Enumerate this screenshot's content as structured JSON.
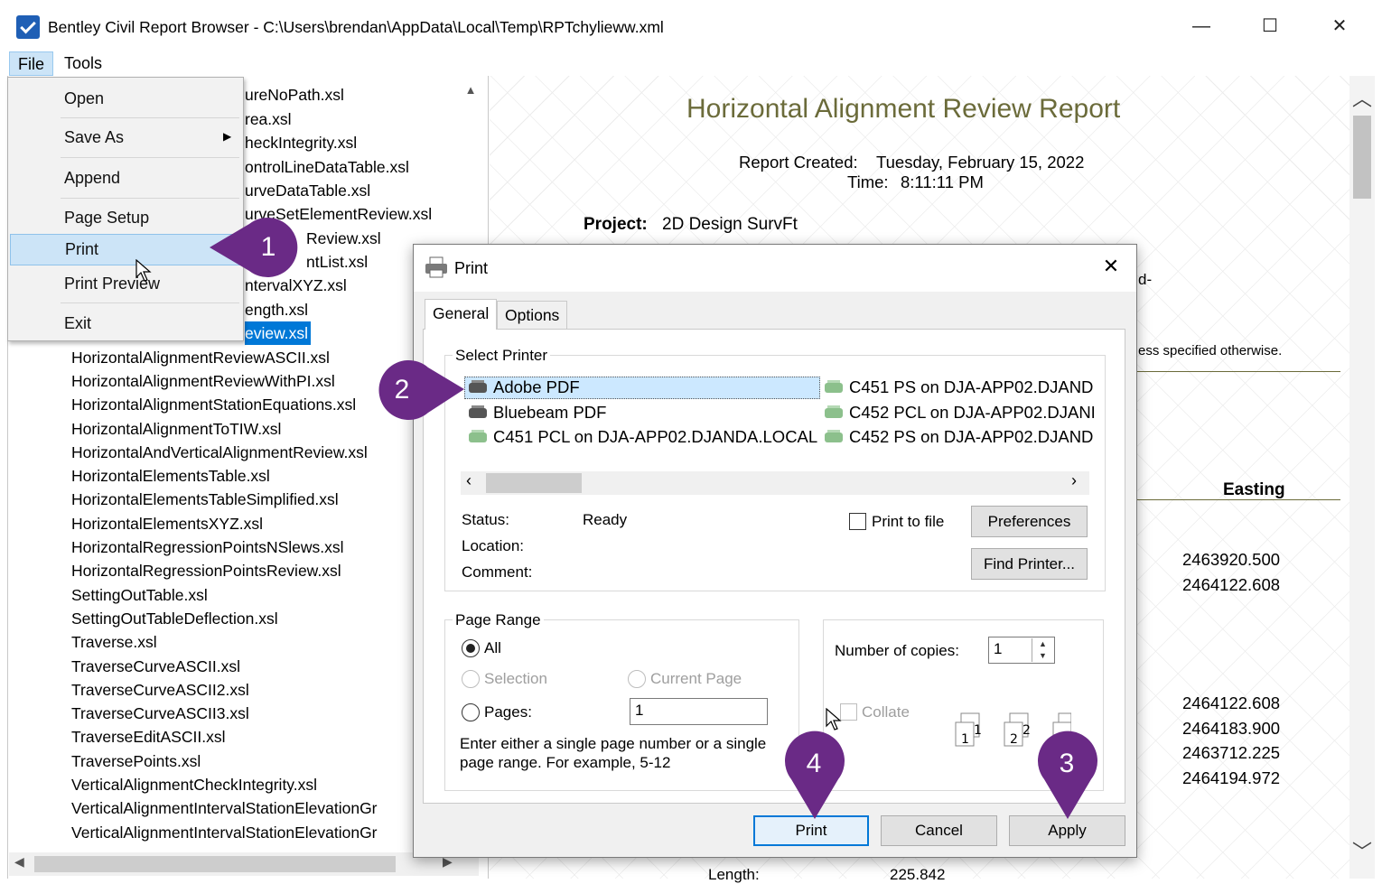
{
  "window": {
    "title": "Bentley Civil Report Browser - C:\\Users\\brendan\\AppData\\Local\\Temp\\RPTchylieww.xml",
    "minimize": "—",
    "maximize": "☐",
    "close": "✕"
  },
  "menubar": {
    "file": "File",
    "tools": "Tools"
  },
  "file_menu": {
    "open": "Open",
    "save_as": "Save As",
    "append": "Append",
    "page_setup": "Page Setup",
    "print": "Print",
    "print_preview": "Print Preview",
    "exit": "Exit"
  },
  "xsl_list": {
    "partial_rows": [
      "ureNoPath.xsl",
      "rea.xsl",
      "heckIntegrity.xsl",
      "ontrolLineDataTable.xsl",
      "urveDataTable.xsl",
      "urveSetElementReview.xsl",
      "Review.xsl",
      "ntList.xsl",
      "ntervalXYZ.xsl",
      "ength.xsl",
      "eview.xsl"
    ],
    "rows": [
      "HorizontalAlignmentReviewASCII.xsl",
      "HorizontalAlignmentReviewWithPI.xsl",
      "HorizontalAlignmentStationEquations.xsl",
      "HorizontalAlignmentToTIW.xsl",
      "HorizontalAndVerticalAlignmentReview.xsl",
      "HorizontalElementsTable.xsl",
      "HorizontalElementsTableSimplified.xsl",
      "HorizontalElementsXYZ.xsl",
      "HorizontalRegressionPointsNSlews.xsl",
      "HorizontalRegressionPointsReview.xsl",
      "SettingOutTable.xsl",
      "SettingOutTableDeflection.xsl",
      "Traverse.xsl",
      "TraverseCurveASCII.xsl",
      "TraverseCurveASCII2.xsl",
      "TraverseCurveASCII3.xsl",
      "TraverseEditASCII.xsl",
      "TraversePoints.xsl",
      "VerticalAlignmentCheckIntegrity.xsl",
      "VerticalAlignmentIntervalStationElevationGr",
      "VerticalAlignmentIntervalStationElevationGr"
    ]
  },
  "report": {
    "title": "Horizontal Alignment Review Report",
    "created_label": "Report Created:",
    "created_value": "Tuesday, February 15, 2022",
    "time_label": "Time:",
    "time_value": "8:11:11 PM",
    "project_label": "Project:",
    "project_value": "2D Design SurvFt",
    "fragment_dash": "d-",
    "fragment_note": "ess specified otherwise.",
    "easting_header": "Easting",
    "easting_values": [
      "2463920.500",
      "2464122.608",
      "2464122.608",
      "2464183.900",
      "2463712.225",
      "2464194.972"
    ],
    "length_label": "Length:",
    "length_value": "225.842"
  },
  "print_dialog": {
    "title": "Print",
    "close": "✕",
    "tabs": [
      "General",
      "Options"
    ],
    "select_printer_label": "Select Printer",
    "printers_col1": [
      "Adobe PDF",
      "Bluebeam PDF",
      "C451 PCL on DJA-APP02.DJANDA.LOCAL"
    ],
    "printers_col2": [
      "C451 PS on DJA-APP02.DJAND",
      "C452 PCL on DJA-APP02.DJANI",
      "C452 PS on DJA-APP02.DJAND"
    ],
    "status_label": "Status:",
    "status_value": "Ready",
    "location_label": "Location:",
    "comment_label": "Comment:",
    "print_to_file": "Print to file",
    "preferences": "Preferences",
    "find_printer": "Find Printer...",
    "page_range_label": "Page Range",
    "all": "All",
    "selection": "Selection",
    "current_page": "Current Page",
    "pages": "Pages:",
    "pages_value": "1",
    "hint_line1": "Enter either a single page number or a single",
    "hint_line2": "page range.  For example, 5-12",
    "copies_label": "Number of copies:",
    "copies_value": "1",
    "collate": "Collate",
    "print_btn": "Print",
    "cancel_btn": "Cancel",
    "apply_btn": "Apply"
  },
  "markers": [
    "1",
    "2",
    "3",
    "4"
  ],
  "colors": {
    "marker": "#6a2a86",
    "selection": "#cce4f7",
    "report_title": "#6b6b3a"
  }
}
